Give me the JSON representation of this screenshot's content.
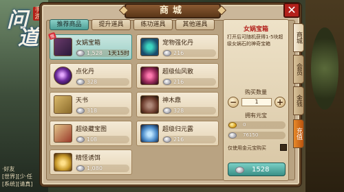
{
  "game": {
    "logo_chars": [
      "问",
      "道"
    ],
    "logo_seal": "手游",
    "chat_lines": [
      "·好友",
      "[世界][少·任",
      "[系统][请真]"
    ]
  },
  "window": {
    "title": "商城",
    "close_label": "✕"
  },
  "tabs": [
    {
      "label": "推荐商品",
      "active": true
    },
    {
      "label": "提升道具",
      "active": false
    },
    {
      "label": "练功道具",
      "active": false
    },
    {
      "label": "其他道具",
      "active": false
    }
  ],
  "items": [
    {
      "name": "女娲宝箱",
      "price": "1,528",
      "currency": "silver",
      "timer": "1天15时",
      "badge": "限",
      "selected": true,
      "icon": "treasure-chest-icon"
    },
    {
      "name": "宠物强化丹",
      "price": "216",
      "currency": "silver",
      "timer": "",
      "badge": "",
      "selected": false,
      "icon": "pill-orb-icon"
    },
    {
      "name": "点化丹",
      "price": "328",
      "currency": "silver",
      "timer": "",
      "badge": "",
      "selected": false,
      "icon": "purple-orb-icon"
    },
    {
      "name": "超级仙风散",
      "price": "216",
      "currency": "silver",
      "timer": "",
      "badge": "",
      "selected": false,
      "icon": "pink-powder-icon"
    },
    {
      "name": "天书",
      "price": "318",
      "currency": "silver",
      "timer": "",
      "badge": "",
      "selected": false,
      "icon": "scroll-book-icon"
    },
    {
      "name": "神木鼎",
      "price": "328",
      "currency": "silver",
      "timer": "",
      "badge": "",
      "selected": false,
      "icon": "cauldron-icon"
    },
    {
      "name": "超级藏宝图",
      "price": "108",
      "currency": "silver",
      "timer": "",
      "badge": "",
      "selected": false,
      "icon": "treasure-map-icon"
    },
    {
      "name": "超级归元露",
      "price": "216",
      "currency": "silver",
      "timer": "",
      "badge": "",
      "selected": false,
      "icon": "potion-vase-icon"
    },
    {
      "name": "精怪诱饵",
      "price": "1,080",
      "currency": "silver",
      "timer": "",
      "badge": "",
      "selected": false,
      "icon": "bait-icon"
    }
  ],
  "detail": {
    "title": "女娲宝箱",
    "description": "打开后可随机获得1-5块超级女娲石的神奇宝箱",
    "quantity_label": "购买数量",
    "quantity": "1",
    "owned_label": "拥有元宝",
    "owned_gold": "0",
    "owned_silver": "76150",
    "gold_only_label": "仅使用金元宝购买",
    "buy_price": "1528"
  },
  "side_tabs": [
    {
      "label": "商城",
      "active": true
    },
    {
      "label": "会员",
      "active": false
    },
    {
      "label": "金钱",
      "active": false
    },
    {
      "label": "充值",
      "active": false
    }
  ],
  "colors": {
    "accent_teal": "#4e9f96",
    "close_red": "#b3201b",
    "recharge_orange": "#e88a2a",
    "detail_title_red": "#b3201b"
  }
}
